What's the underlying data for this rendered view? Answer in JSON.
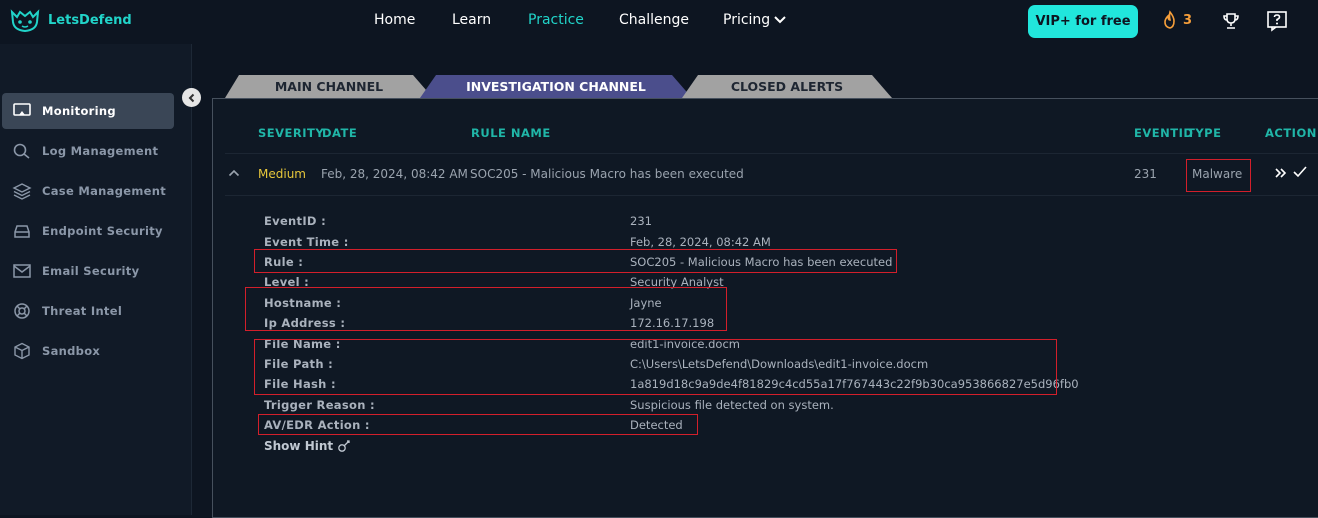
{
  "brand": {
    "name": "LetsDefend"
  },
  "nav": [
    {
      "label": "Home",
      "active": false
    },
    {
      "label": "Learn",
      "active": false
    },
    {
      "label": "Practice",
      "active": true
    },
    {
      "label": "Challenge",
      "active": false
    },
    {
      "label": "Pricing",
      "active": false
    }
  ],
  "cta": {
    "vip_label": "VIP+ for free"
  },
  "streak": {
    "count": "3"
  },
  "sidebar": {
    "items": [
      {
        "label": "Monitoring",
        "icon": "monitor-icon",
        "active": true
      },
      {
        "label": "Log Management",
        "icon": "search-icon"
      },
      {
        "label": "Case Management",
        "icon": "layers-icon"
      },
      {
        "label": "Endpoint Security",
        "icon": "hdd-icon"
      },
      {
        "label": "Email Security",
        "icon": "mail-icon"
      },
      {
        "label": "Threat Intel",
        "icon": "lifebuoy-icon"
      },
      {
        "label": "Sandbox",
        "icon": "cube-icon"
      }
    ]
  },
  "tabs": [
    {
      "label": "MAIN CHANNEL",
      "active": false
    },
    {
      "label": "INVESTIGATION CHANNEL",
      "active": true
    },
    {
      "label": "CLOSED ALERTS",
      "active": false
    }
  ],
  "table": {
    "headers": {
      "severity": "SEVERITY",
      "date": "DATE",
      "rule": "RULE NAME",
      "eventid": "EVENTID",
      "type": "TYPE",
      "action": "ACTION"
    },
    "row": {
      "severity": "Medium",
      "date": "Feb, 28, 2024, 08:42 AM",
      "rule": "SOC205 - Malicious Macro has been executed",
      "eventid": "231",
      "type": "Malware"
    }
  },
  "details": [
    {
      "label": "EventID :",
      "value": "231"
    },
    {
      "label": "Event Time :",
      "value": "Feb, 28, 2024, 08:42 AM"
    },
    {
      "label": "Rule :",
      "value": "SOC205 - Malicious Macro has been executed"
    },
    {
      "label": "Level :",
      "value": "Security Analyst"
    },
    {
      "label": "Hostname :",
      "value": "Jayne"
    },
    {
      "label": "Ip Address :",
      "value": "172.16.17.198"
    },
    {
      "label": "File Name :",
      "value": "edit1-invoice.docm"
    },
    {
      "label": "File Path :",
      "value": "C:\\Users\\LetsDefend\\Downloads\\edit1-invoice.docm"
    },
    {
      "label": "File Hash :",
      "value": "1a819d18c9a9de4f81829c4cd55a17f767443c22f9b30ca953866827e5d96fb0"
    },
    {
      "label": "Trigger Reason :",
      "value": "Suspicious file detected on system."
    },
    {
      "label": "AV/EDR Action :",
      "value": "Detected"
    }
  ],
  "show_hint": {
    "label": "Show Hint"
  },
  "colors": {
    "accent": "#21d4c9",
    "header_teal": "#20b6a8",
    "highlight_red": "#d21f2b",
    "severity_medium": "#e7c73b"
  }
}
